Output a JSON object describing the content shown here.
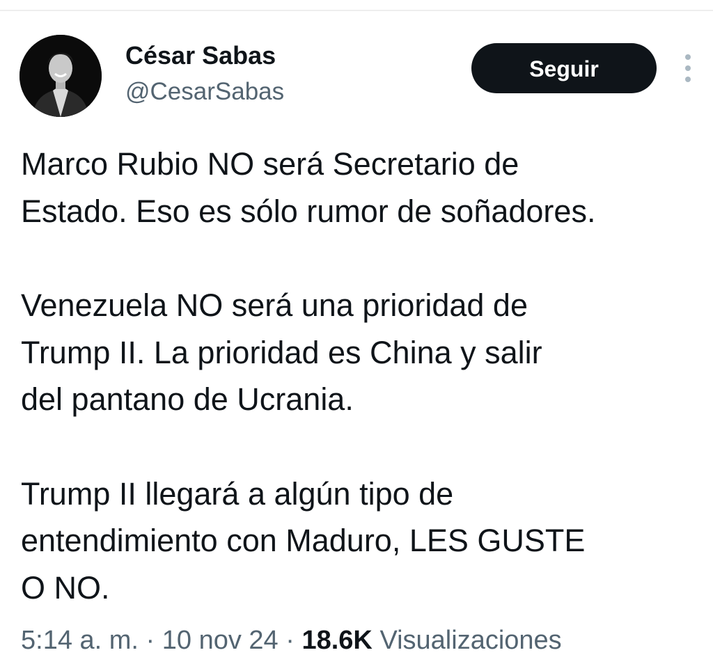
{
  "author": {
    "name": "César Sabas",
    "handle": "@CesarSabas"
  },
  "actions": {
    "follow_label": "Seguir",
    "more_icon": "more-vertical-icon"
  },
  "tweet": {
    "paragraphs": [
      "Marco Rubio NO será Secretario de\nEstado. Eso es sólo rumor de soñadores.",
      "Venezuela NO será una prioridad de\nTrump II.  La prioridad es China y salir\ndel pantano de Ucrania.",
      "Trump II llegará a algún tipo de\nentendimiento con Maduro, LES GUSTE\nO NO."
    ]
  },
  "meta": {
    "time": "5:14 a. m.",
    "separator": "·",
    "date": "10 nov 24",
    "views_count": "18.6K",
    "views_label": "Visualizaciones"
  },
  "colors": {
    "text_primary": "#0f1419",
    "text_secondary": "#536471",
    "button_bg": "#0f1419",
    "button_text": "#ffffff"
  }
}
